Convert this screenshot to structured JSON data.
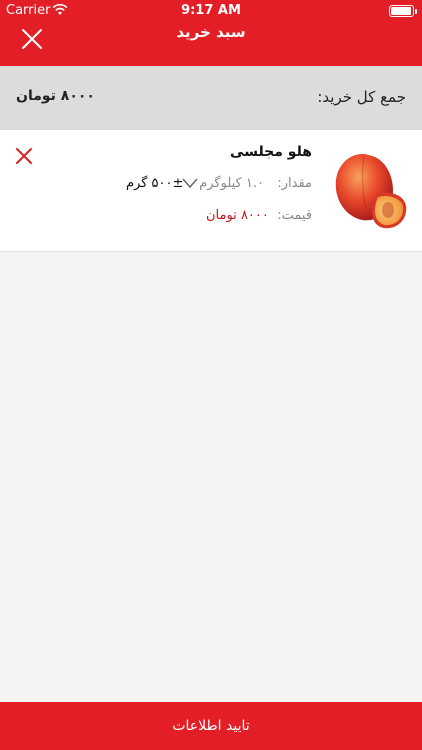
{
  "status_bar": {
    "carrier": "Carrier",
    "time": "9:17 AM"
  },
  "header": {
    "title": "سبد خرید",
    "close_icon": "close-icon"
  },
  "total": {
    "label": "جمع کل خرید:",
    "amount": "۸۰۰۰ تومان"
  },
  "cart_items": [
    {
      "name": "هلو مجلسی",
      "quantity_label": "مقدار:",
      "quantity_value": "۱.۰ کیلوگرم",
      "unit_option": "۵۰۰± گرم",
      "price_label": "قیمت:",
      "price_value": "۸۰۰۰ تومان",
      "image_icon": "peach-image"
    }
  ],
  "footer": {
    "confirm_label": "تایید اطلاعات"
  },
  "colors": {
    "brand_red": "#e31e26",
    "price_red": "#c0161d",
    "total_bar": "#dcdcdc"
  }
}
